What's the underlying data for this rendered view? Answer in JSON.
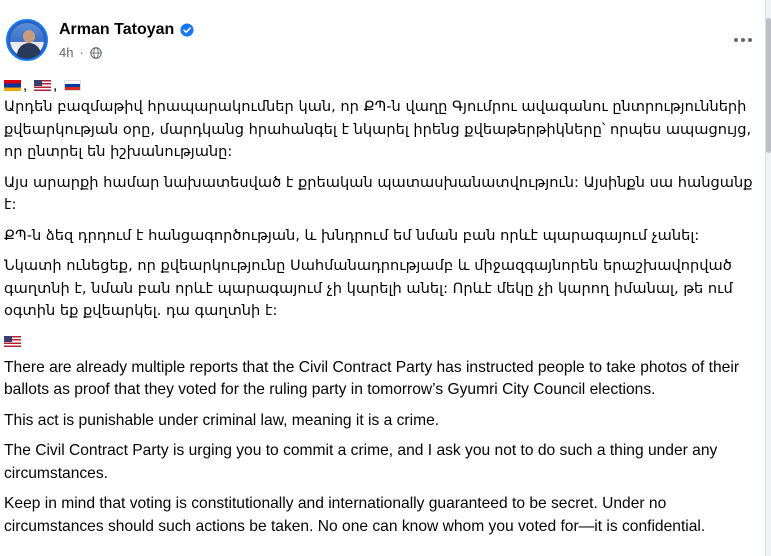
{
  "post": {
    "author": "Arman Tatoyan",
    "time": "4h",
    "flags_top": [
      "armenia-flag",
      "usa-flag",
      "russia-flag"
    ],
    "armenian_paragraphs": [
      "Արդեն բազմաթիվ հրապարակումներ կան, որ ՔՊ-ն վաղը Գյումրու ավագանու ընտրությունների քվեարկության օրը, մարդկանց հրահանգել է նկարել իրենց քվեաթերթիկները՝ որպես ապացույց, որ ընտրել են իշխանությանը:",
      "Այս արարքի համար նախատեսված է քրեական  պատասխանատվություն: Այսինքն սա հանցանք է:",
      "ՔՊ-ն ձեզ դրդում է հանցագործության, և խնդրում եմ նման բան որևէ պարագայում չանել:",
      "Նկատի ունեցեք, որ քվեարկությունը Սահմանադրությամբ և միջազգայնորեն երաշխավորված գաղտնի է, նման բան որևէ պարագայում չի կարելի անել: Որևէ մեկը չի կարող իմանալ, թե ում օգտին եք քվեարկել. դա գաղտնի է:"
    ],
    "english_paragraphs": [
      "There are already multiple reports that the Civil Contract Party has instructed people to take photos of their ballots as proof that they voted for the ruling party in tomorrow’s Gyumri City Council elections.",
      "This act is punishable under criminal law, meaning it is a crime.",
      "The Civil Contract Party is urging you to commit a crime, and I ask you not to do such a thing under any circumstances.",
      "Keep in mind that voting is constitutionally and internationally guaranteed to be secret. Under no circumstances should such actions be taken. No one can know whom you voted for—it is confidential."
    ]
  },
  "colors": {
    "verified_blue": "#1877f2",
    "text_primary": "#050505",
    "text_secondary": "#65676b"
  },
  "icons": {
    "verified": "verified-badge-icon",
    "audience": "globe-icon",
    "menu": "more-options-icon"
  }
}
